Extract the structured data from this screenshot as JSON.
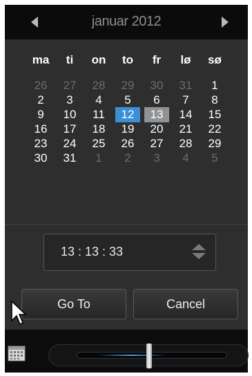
{
  "header": {
    "month_title": "januar 2012",
    "prev_icon": "triangle-left-icon",
    "next_icon": "triangle-right-icon"
  },
  "weekdays": [
    "ma",
    "ti",
    "on",
    "to",
    "fr",
    "lø",
    "sø"
  ],
  "weeks": [
    [
      {
        "d": "26",
        "m": true
      },
      {
        "d": "27",
        "m": true
      },
      {
        "d": "28",
        "m": true
      },
      {
        "d": "29",
        "m": true
      },
      {
        "d": "30",
        "m": true
      },
      {
        "d": "31",
        "m": true
      },
      {
        "d": "1"
      }
    ],
    [
      {
        "d": "2"
      },
      {
        "d": "3"
      },
      {
        "d": "4"
      },
      {
        "d": "5"
      },
      {
        "d": "6"
      },
      {
        "d": "7"
      },
      {
        "d": "8"
      }
    ],
    [
      {
        "d": "9"
      },
      {
        "d": "10"
      },
      {
        "d": "11"
      },
      {
        "d": "12",
        "s": "selected"
      },
      {
        "d": "13",
        "s": "today"
      },
      {
        "d": "14"
      },
      {
        "d": "15"
      }
    ],
    [
      {
        "d": "16"
      },
      {
        "d": "17"
      },
      {
        "d": "18"
      },
      {
        "d": "19"
      },
      {
        "d": "20"
      },
      {
        "d": "21"
      },
      {
        "d": "22"
      }
    ],
    [
      {
        "d": "23"
      },
      {
        "d": "24"
      },
      {
        "d": "25"
      },
      {
        "d": "26"
      },
      {
        "d": "27"
      },
      {
        "d": "28"
      },
      {
        "d": "29"
      }
    ],
    [
      {
        "d": "30"
      },
      {
        "d": "31"
      },
      {
        "d": "1",
        "m": true
      },
      {
        "d": "2",
        "m": true
      },
      {
        "d": "3",
        "m": true
      },
      {
        "d": "4",
        "m": true
      },
      {
        "d": "5",
        "m": true
      }
    ]
  ],
  "time": {
    "value": "13 : 13 : 33"
  },
  "buttons": {
    "goto_label": "Go To",
    "cancel_label": "Cancel"
  },
  "bottom": {
    "calendar_icon": "calendar-icon",
    "slider_position": 0.5
  },
  "colors": {
    "selected_day": "#3c8fd6",
    "today_day": "#8f9396",
    "panel_bg": "#2e2e2e",
    "header_bg": "#0b0b0b"
  }
}
